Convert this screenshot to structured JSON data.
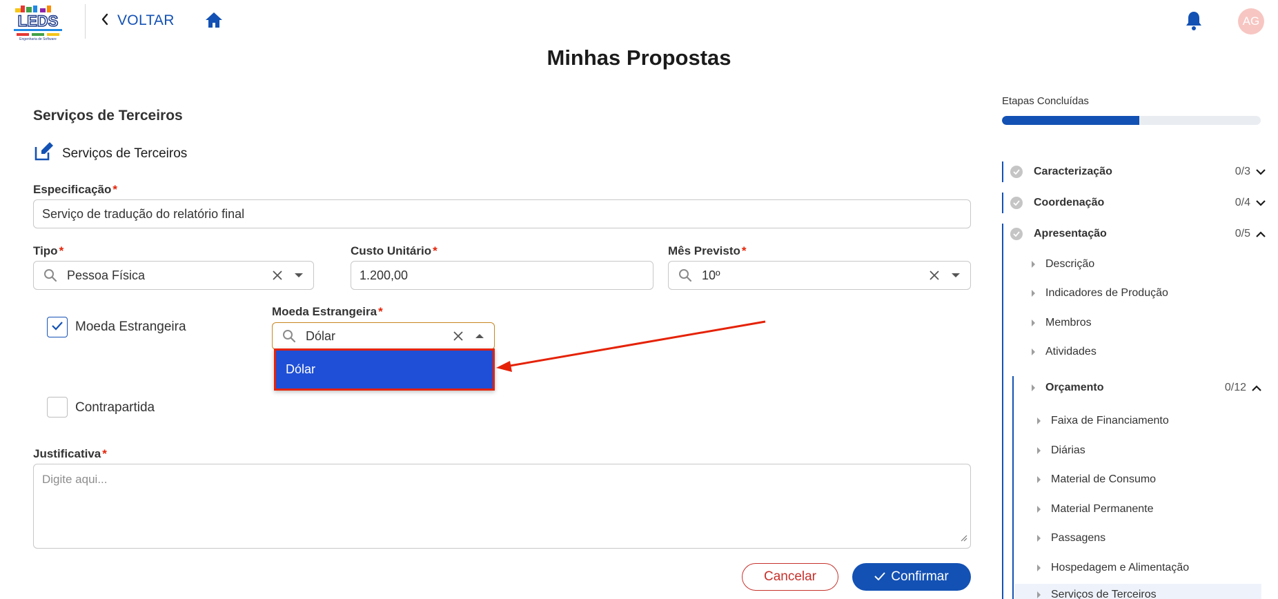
{
  "header": {
    "logo_text": "LEDS",
    "logo_subtext": "Engenharia de Software",
    "back_label": "VOLTAR",
    "avatar_initials": "AG"
  },
  "page_title": "Minhas Propostas",
  "form": {
    "section_title": "Serviços de Terceiros",
    "edit_label": "Serviços de Terceiros",
    "especificacao": {
      "label": "Especificação",
      "required_mark": "*",
      "value": "Serviço de tradução do relatório final"
    },
    "tipo": {
      "label": "Tipo",
      "required_mark": "*",
      "value": "Pessoa Física"
    },
    "custo_unitario": {
      "label": "Custo Unitário",
      "required_mark": "*",
      "value": "1.200,00"
    },
    "mes_previsto": {
      "label": "Mês Previsto",
      "required_mark": "*",
      "value": "10º"
    },
    "moeda_checkbox": {
      "label": "Moeda Estrangeira",
      "checked": true
    },
    "moeda_select": {
      "label": "Moeda Estrangeira",
      "required_mark": "*",
      "value": "Dólar",
      "options": [
        "Dólar"
      ]
    },
    "contrapartida": {
      "label": "Contrapartida",
      "checked": false
    },
    "justificativa": {
      "label": "Justificativa",
      "required_mark": "*",
      "placeholder": "Digite aqui..."
    },
    "cancel_label": "Cancelar",
    "confirm_label": "Confirmar"
  },
  "sidebar": {
    "progress_label": "Etapas Concluídas",
    "progress_fraction": 0.53,
    "stages": [
      {
        "label": "Caracterização",
        "count": "0/3",
        "expanded": false
      },
      {
        "label": "Coordenação",
        "count": "0/4",
        "expanded": false
      },
      {
        "label": "Apresentação",
        "count": "0/5",
        "expanded": true
      }
    ],
    "apresentacao_items": [
      "Descrição",
      "Indicadores de Produção",
      "Membros",
      "Atividades"
    ],
    "orcamento": {
      "label": "Orçamento",
      "count": "0/12"
    },
    "orcamento_items": [
      "Faixa de Financiamento",
      "Diárias",
      "Material de Consumo",
      "Material Permanente",
      "Passagens",
      "Hospedagem e Alimentação",
      "Serviços de Terceiros"
    ]
  },
  "colors": {
    "primary": "#1351b4",
    "danger": "#e52207",
    "dropdown_highlight": "#1f4fd6",
    "annotation_arrow": "#e52207"
  }
}
